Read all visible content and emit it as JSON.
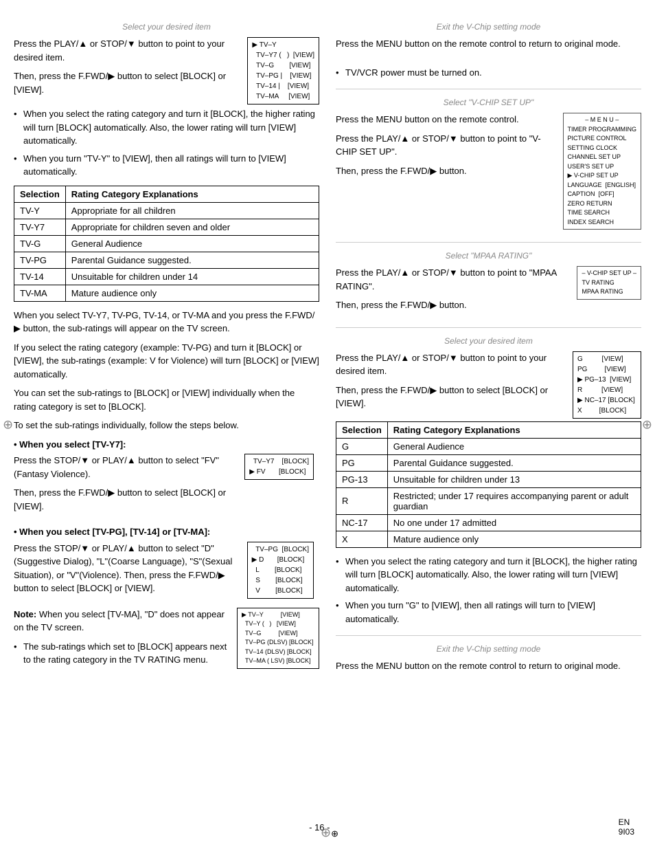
{
  "left": {
    "section1_title": "Select your desired item",
    "section1_para1": "Press the PLAY/▲ or STOP/▼ button to point to your desired item.",
    "section1_para2": "Then, press the F.FWD/▶ button to select [BLOCK] or [VIEW].",
    "bullet1": "When you select the rating category and turn it [BLOCK], the higher rating will turn [BLOCK] automatically. Also, the lower rating will turn [VIEW] automatically.",
    "bullet2": "When you turn \"TV-Y\" to [VIEW], then all ratings will turn to [VIEW] automatically.",
    "table1_col1": "Selection",
    "table1_col2": "Rating Category Explanations",
    "table1_rows": [
      [
        "TV-Y",
        "Appropriate for all children"
      ],
      [
        "TV-Y7",
        "Appropriate for children seven and older"
      ],
      [
        "TV-G",
        "General Audience"
      ],
      [
        "TV-PG",
        "Parental Guidance suggested."
      ],
      [
        "TV-14",
        "Unsuitable for children under 14"
      ],
      [
        "TV-MA",
        "Mature audience only"
      ]
    ],
    "para_after_table1": "When you select TV-Y7, TV-PG, TV-14, or TV-MA and you press the F.FWD/▶ button, the sub-ratings will appear on the TV screen.",
    "para_subrating": "If you select the rating category (example: TV-PG) and turn it [BLOCK] or [VIEW], the sub-ratings (example: V for Violence) will turn [BLOCK] or [VIEW] automatically.",
    "para_subrating2": "You can set the sub-ratings to [BLOCK] or [VIEW] individually when the rating category is set to [BLOCK].",
    "para_steps": "To set the sub-ratings individually, follow the steps below.",
    "when_tvy7_bold": "• When you select [TV-Y7]:",
    "when_tvy7_text1": "Press the STOP/▼ or PLAY/▲ button to select \"FV\" (Fantasy Violence).",
    "when_tvy7_text2": "Then, press the F.FWD/▶ button to select [BLOCK] or [VIEW].",
    "when_tvpg_bold": "• When you select [TV-PG], [TV-14] or [TV-MA]:",
    "when_tvpg_text1": "Press the STOP/▼ or PLAY/▲ button to select \"D\"(Suggestive Dialog), \"L\"(Coarse Language), \"S\"(Sexual Situation), or \"V\"(Violence). Then, press the F.FWD/▶ button to select [BLOCK] or [VIEW].",
    "note_text": "Note: When you select [TV-MA], \"D\" does not appear on the TV screen.",
    "bullet_subrating_block": "The sub-ratings which set to [BLOCK] appears next to the rating category in the TV RATING menu.",
    "mini_box1": {
      "lines": [
        "▶ TV–Y",
        "  TV–Y7 (    )    [VIEW]",
        "  TV–G             [VIEW]",
        "  TV–PG |          [VIEW]",
        "  TV–14 |          [VIEW]",
        "  TV–MA             [VIEW]"
      ]
    },
    "mini_box_tvy7": {
      "lines": [
        "  TV–Y7          [BLOCK]",
        "▶ FV              [BLOCK]"
      ]
    },
    "mini_box_tvpg": {
      "lines": [
        "  TV–PG    [BLOCK]",
        "▶ D         [BLOCK]",
        "  L          [BLOCK]",
        "  S          [BLOCK]",
        "  V          [BLOCK]"
      ]
    },
    "mini_box_final": {
      "lines": [
        "▶ TV–Y              [VIEW]",
        "  TV–Y (    )       [VIEW]",
        "  TV–G               [VIEW]",
        "  TV–PG (DLSV)    [BLOCK]",
        "  TV–14 (DLSV)    [BLOCK]",
        "  TV–MA ( LSV)    [BLOCK]"
      ]
    }
  },
  "right": {
    "exit_title": "Exit the V-Chip setting mode",
    "exit_para": "Press the MENU button on the remote control to return to original mode.",
    "tvvcr_bullet": "TV/VCR power must be turned on.",
    "vchip_title": "Select \"V-CHIP SET UP\"",
    "vchip_para1": "Press the MENU button on the remote control.",
    "vchip_para2": "Press the PLAY/▲ or STOP/▼ button to point to \"V-CHIP SET UP\".",
    "vchip_para3": "Then, press the F.FWD/▶ button.",
    "mpaa_title": "Select \"MPAA RATING\"",
    "mpaa_para1": "Press the PLAY/▲ or STOP/▼ button to point to \"MPAA RATING\".",
    "mpaa_para2": "Then, press the F.FWD/▶ button.",
    "desired_title": "Select your desired item",
    "desired_para1": "Press the PLAY/▲ or STOP/▼ button to point to your desired item.",
    "desired_para2": "Then, press the F.FWD/▶ button to select [BLOCK] or [VIEW].",
    "table2_col1": "Selection",
    "table2_col2": "Rating Category Explanations",
    "table2_rows": [
      [
        "G",
        "General Audience"
      ],
      [
        "PG",
        "Parental Guidance suggested."
      ],
      [
        "PG-13",
        "Unsuitable for children under 13"
      ],
      [
        "R",
        "Restricted; under 17 requires accompanying parent or adult guardian"
      ],
      [
        "NC-17",
        "No one under 17 admitted"
      ],
      [
        "X",
        "Mature audience only"
      ]
    ],
    "bullet_high": "When you select the rating category and turn it [BLOCK], the higher rating will turn [BLOCK] automatically.  Also, the lower rating will turn [VIEW] automatically.",
    "bullet_g": "When you turn \"G\" to [VIEW], then all ratings will turn to [VIEW] automatically.",
    "exit2_title": "Exit the V-Chip setting mode",
    "exit2_para": "Press the MENU button on the remote control to return to original mode.",
    "menu_box": {
      "title": "– M E N U –",
      "lines": [
        "TIMER PROGRAMMING",
        "PICTURE CONTROL",
        "SETTING CLOCK",
        "CHANNEL SET UP",
        "USER'S SET UP",
        "▶ V-CHIP SET UP",
        "LANGUAGE  [ENGLISH]",
        "CAPTION  [OFF]",
        "ZERO RETURN",
        "TIME SEARCH",
        "INDEX SEARCH"
      ]
    },
    "vchip_setup_box": {
      "title": "– V-CHIP SET UP –",
      "lines": [
        "TV RATING",
        "MPAA RATING"
      ]
    },
    "desired_box": {
      "lines": [
        "G           [VIEW]",
        "PG          [VIEW]",
        "▶ PG–13    [VIEW]",
        "R           [VIEW]",
        "▶ NC–17   [BLOCK]",
        "X           [BLOCK]"
      ]
    }
  },
  "footer": {
    "page_number": "- 16 -",
    "lang": "EN",
    "code": "9I03"
  }
}
